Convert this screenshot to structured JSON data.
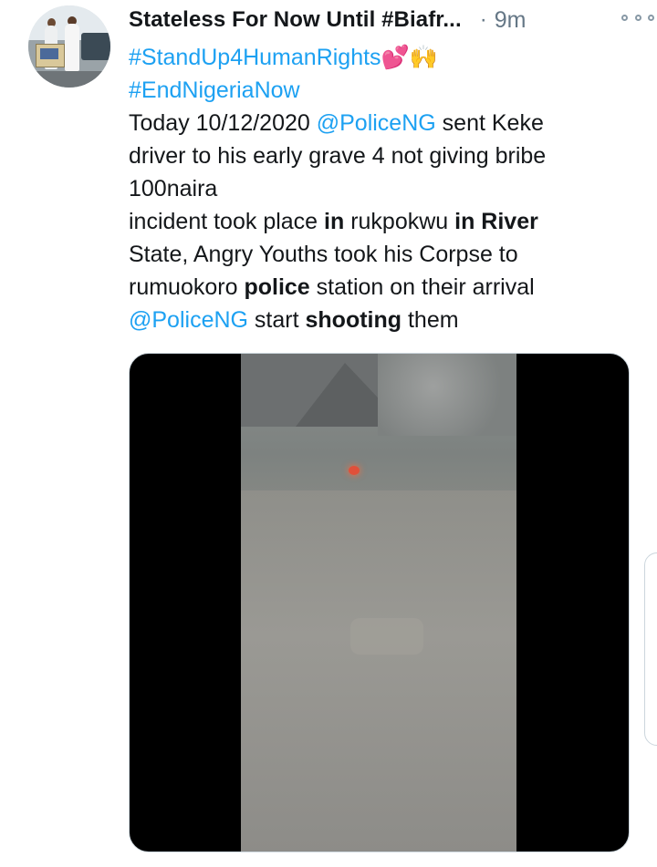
{
  "tweet": {
    "author_name": "Stateless For Now Until #Biafr...",
    "separator": "·",
    "time": "9m",
    "body_lines": [
      {
        "segments": [
          {
            "text": "#StandUp4HumanRights",
            "style": "link"
          },
          {
            "text": "💕🙌",
            "style": "emoji"
          }
        ]
      },
      {
        "segments": [
          {
            "text": "#EndNigeriaNow",
            "style": "link"
          }
        ]
      },
      {
        "segments": [
          {
            "text": "Today 10/12/2020 ",
            "style": "plain"
          },
          {
            "text": "@PoliceNG",
            "style": "link"
          },
          {
            "text": " sent Keke",
            "style": "plain"
          }
        ]
      },
      {
        "segments": [
          {
            "text": "driver to his early grave 4 not giving bribe",
            "style": "plain"
          }
        ]
      },
      {
        "segments": [
          {
            "text": "100naira",
            "style": "plain"
          }
        ]
      },
      {
        "segments": [
          {
            "text": "incident took place ",
            "style": "plain"
          },
          {
            "text": "in",
            "style": "bold"
          },
          {
            "text": " rukpokwu ",
            "style": "plain"
          },
          {
            "text": "in River",
            "style": "bold"
          }
        ]
      },
      {
        "segments": [
          {
            "text": " State, Angry Youths took his Corpse to",
            "style": "plain"
          }
        ]
      },
      {
        "segments": [
          {
            "text": "rumuokoro ",
            "style": "plain"
          },
          {
            "text": "police",
            "style": "bold"
          },
          {
            "text": " station on their arrival",
            "style": "plain"
          }
        ]
      },
      {
        "segments": [
          {
            "text": "@PoliceNG",
            "style": "link"
          },
          {
            "text": " start ",
            "style": "plain"
          },
          {
            "text": "shooting",
            "style": "bold"
          },
          {
            "text": " them",
            "style": "plain"
          }
        ]
      }
    ]
  },
  "colors": {
    "link": "#1da1f2",
    "text": "#14171a",
    "muted": "#657786"
  },
  "icons": {
    "more": "more-options-icon",
    "avatar": "profile-avatar"
  }
}
